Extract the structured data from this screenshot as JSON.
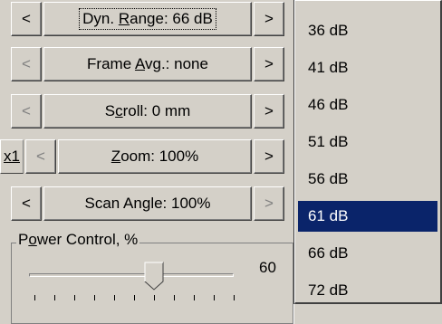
{
  "rows": {
    "dyn_range": {
      "left": "<",
      "label": "Dyn. Range: 66 dB",
      "right": ">"
    },
    "frame_avg": {
      "left": "<",
      "label": "Frame Avg.: none",
      "right": ">"
    },
    "scroll": {
      "left": "<",
      "label": "Scroll: 0 mm",
      "right": ">"
    },
    "zoom": {
      "x1": "x1",
      "left": "<",
      "label": "Zoom: 100%",
      "right": ">"
    },
    "scan_angle": {
      "left": "<",
      "label": "Scan Angle: 100%",
      "right": ">"
    }
  },
  "power_control": {
    "title": "Power Control, %",
    "value": "60",
    "level": 60
  },
  "dropdown": {
    "options": [
      "36 dB",
      "41 dB",
      "46 dB",
      "51 dB",
      "56 dB",
      "61 dB",
      "66 dB",
      "72 dB"
    ],
    "selected": "61 dB"
  },
  "colors": {
    "face": "#d4d0c8",
    "selection": "#0a246a",
    "disabled": "#808080"
  }
}
